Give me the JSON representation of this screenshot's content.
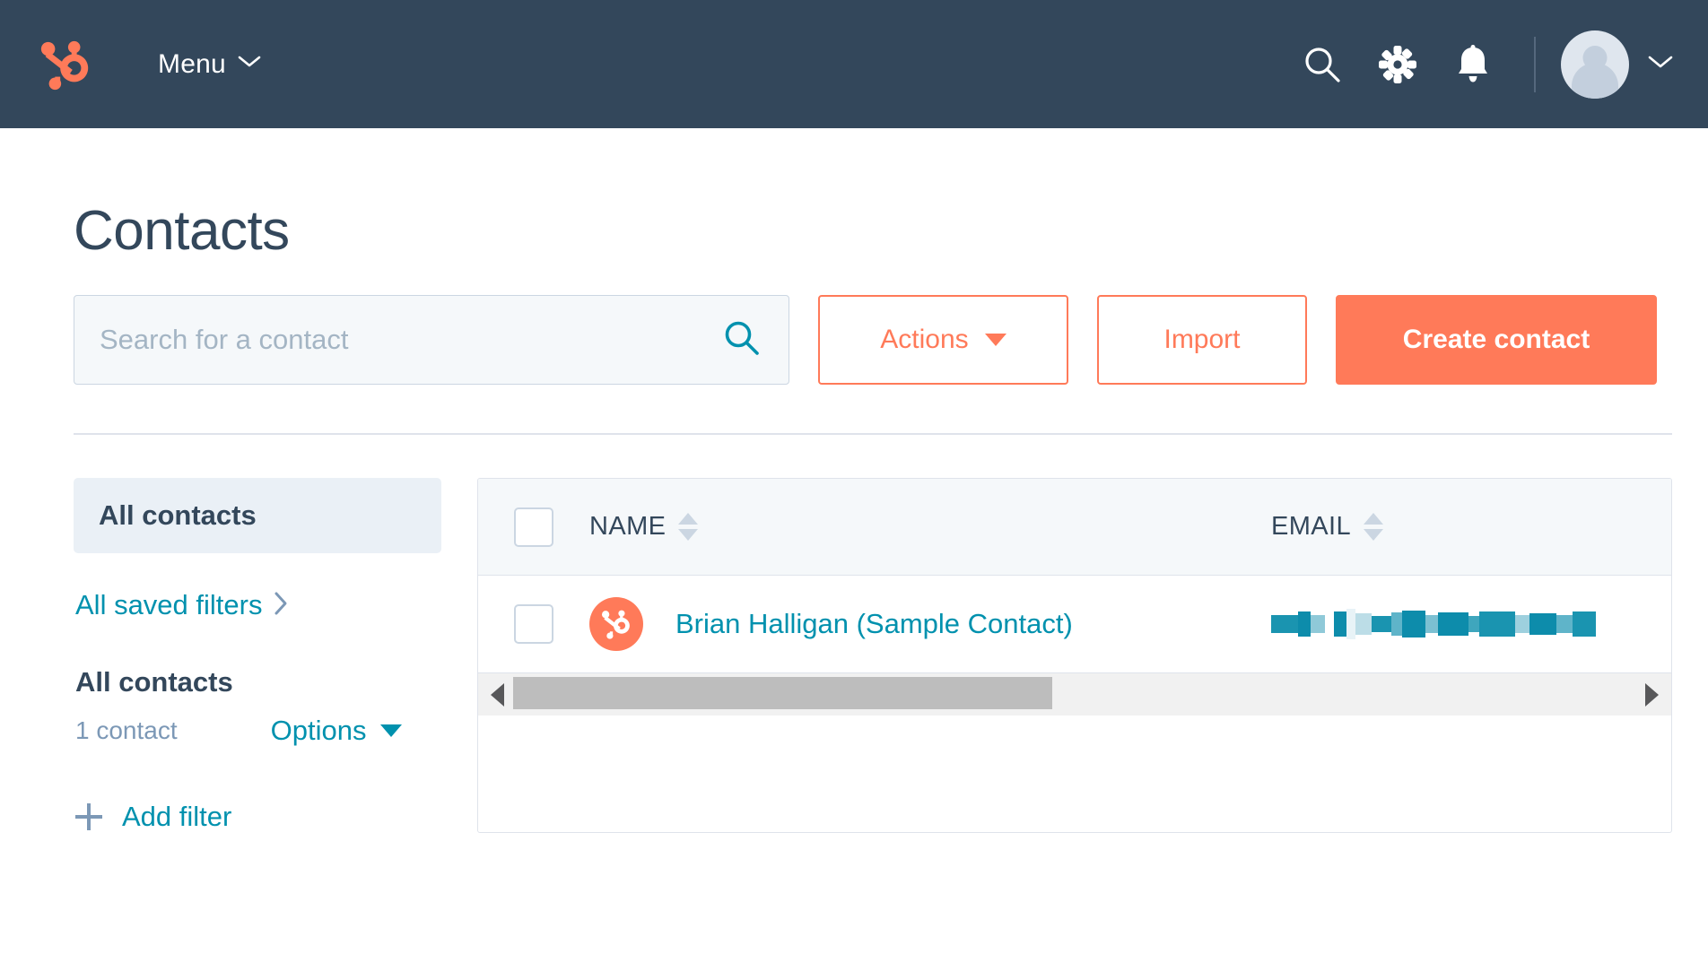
{
  "colors": {
    "nav_bg": "#33475b",
    "brand_orange": "#ff7a59",
    "link_teal": "#0091ae",
    "text_dark": "#33475b",
    "muted": "#7c98b6",
    "panel_bg": "#f5f8fa",
    "highlight_bg": "#eaf0f6",
    "border": "#dfe3eb"
  },
  "topnav": {
    "logo_icon": "hubspot-sprocket-logo",
    "menu_label": "Menu",
    "menu_caret_icon": "chevron-down-icon",
    "icons": [
      {
        "name": "search-icon",
        "label": "Search"
      },
      {
        "name": "gear-icon",
        "label": "Settings"
      },
      {
        "name": "bell-icon",
        "label": "Notifications"
      }
    ],
    "avatar_icon": "user-avatar",
    "avatar_caret_icon": "chevron-down-icon"
  },
  "page": {
    "title": "Contacts"
  },
  "search": {
    "placeholder": "Search for a contact",
    "value": "",
    "icon": "search-icon"
  },
  "toolbar": {
    "actions_label": "Actions",
    "actions_caret_icon": "caret-down-icon",
    "import_label": "Import",
    "create_label": "Create contact"
  },
  "sidebar": {
    "active_filter": "All contacts",
    "saved_filters_label": "All saved filters",
    "saved_filters_chevron_icon": "chevron-right-icon",
    "list_title": "All contacts",
    "list_count": "1 contact",
    "options_label": "Options",
    "options_caret_icon": "caret-down-icon",
    "add_filter_label": "Add filter",
    "add_filter_icon": "plus-icon"
  },
  "table": {
    "columns": [
      {
        "label": "NAME",
        "sort_icon": "sort-icon"
      },
      {
        "label": "EMAIL",
        "sort_icon": "sort-icon"
      }
    ],
    "select_all_checkbox": "unchecked",
    "rows": [
      {
        "checkbox": "unchecked",
        "avatar_icon": "hubspot-sprocket-avatar",
        "name": "Brian Halligan (Sample Contact)",
        "email": "",
        "email_state": "redacted"
      }
    ],
    "scrollbar": {
      "left_arrow_icon": "triangle-left-icon",
      "right_arrow_icon": "triangle-right-icon",
      "thumb_position": "left"
    }
  }
}
